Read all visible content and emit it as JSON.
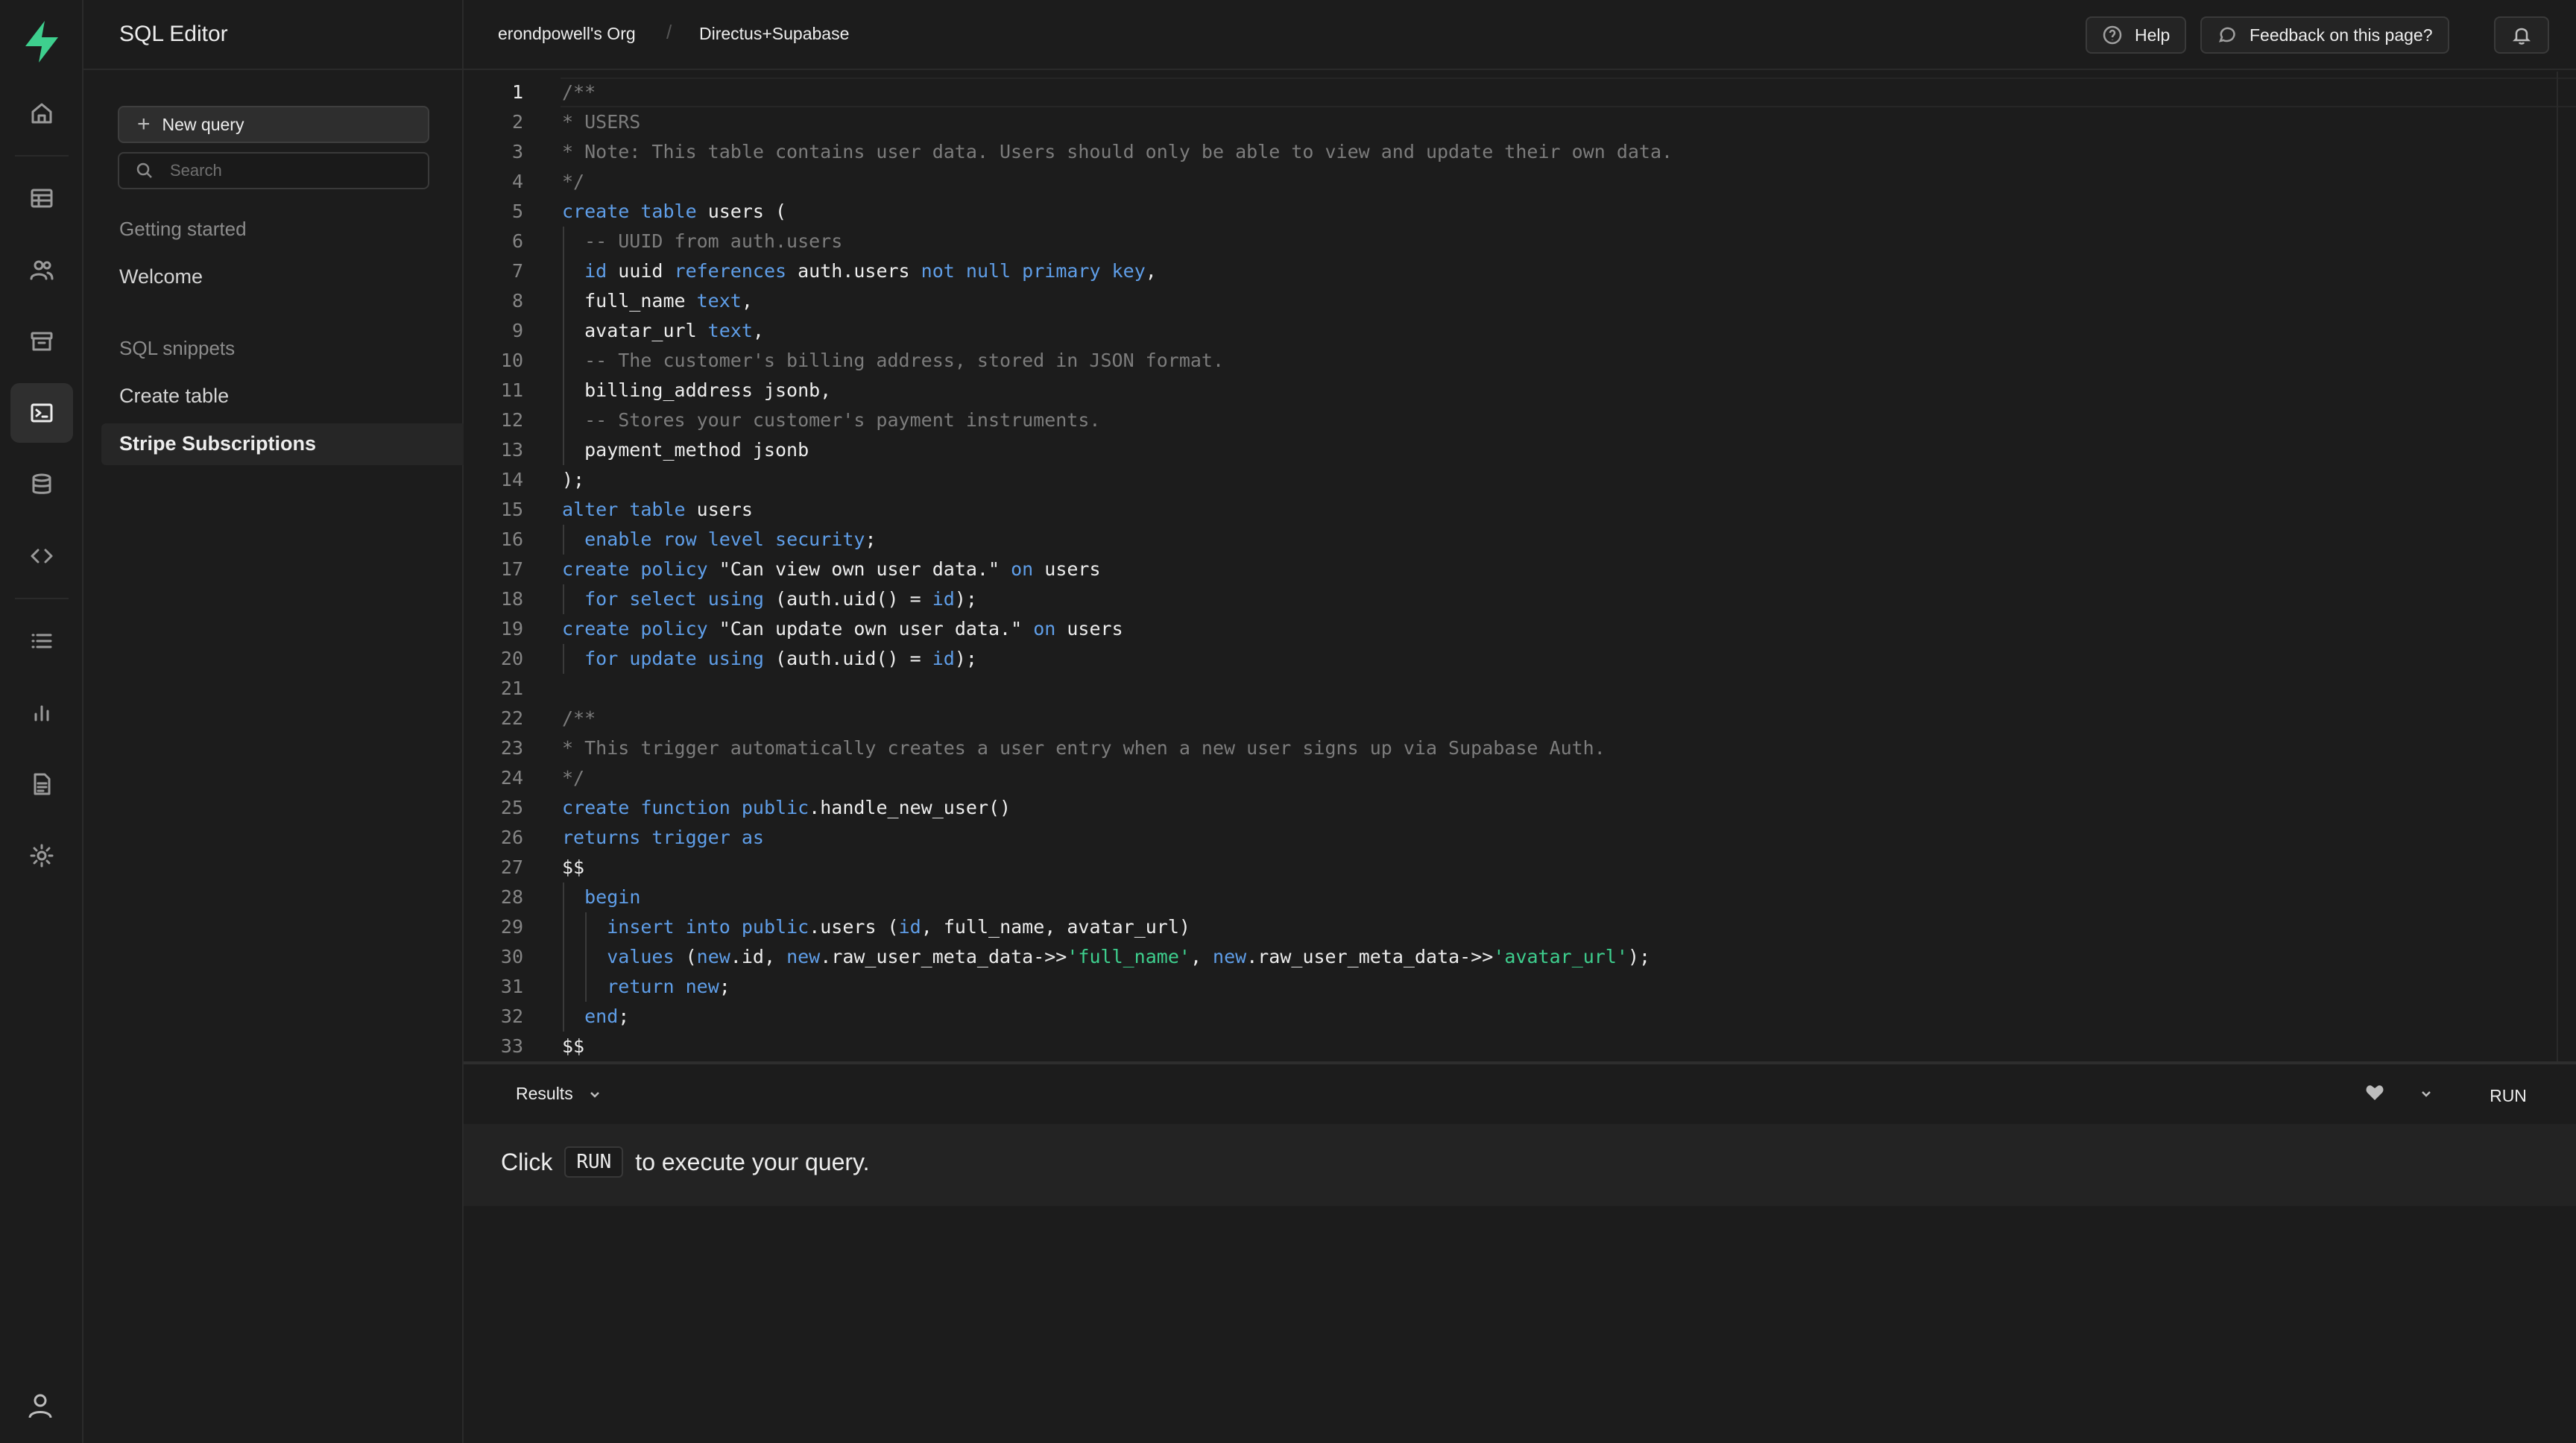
{
  "app": {
    "title": "SQL Editor"
  },
  "rail": {
    "icons": [
      "home-icon",
      "table-editor-icon",
      "users-icon",
      "storage-icon",
      "sql-editor-icon",
      "database-icon",
      "api-icon",
      "logs-icon",
      "reports-icon",
      "docs-icon",
      "settings-icon",
      "account-icon"
    ],
    "active": "sql-editor-icon",
    "brand_color": "#3ecf8e"
  },
  "sidebar": {
    "new_query_label": "New query",
    "search_placeholder": "Search",
    "section_getting_started": "Getting started",
    "item_welcome": "Welcome",
    "section_snippets": "SQL snippets",
    "item_create_table": "Create table",
    "item_active": "Stripe Subscriptions"
  },
  "topbar": {
    "org": "erondpowell's Org",
    "separator": "/",
    "project": "Directus+Supabase",
    "help_label": "Help",
    "feedback_label": "Feedback on this page?"
  },
  "editor": {
    "lines": [
      "/**",
      "* USERS",
      "* Note: This table contains user data. Users should only be able to view and update their own data.",
      "*/",
      "create table users (",
      "  -- UUID from auth.users",
      "  id uuid references auth.users not null primary key,",
      "  full_name text,",
      "  avatar_url text,",
      "  -- The customer's billing address, stored in JSON format.",
      "  billing_address jsonb,",
      "  -- Stores your customer's payment instruments.",
      "  payment_method jsonb",
      ");",
      "alter table users",
      "  enable row level security;",
      "create policy \"Can view own user data.\" on users",
      "  for select using (auth.uid() = id);",
      "create policy \"Can update own user data.\" on users",
      "  for update using (auth.uid() = id);",
      "",
      "/**",
      "* This trigger automatically creates a user entry when a new user signs up via Supabase Auth.",
      "*/",
      "create function public.handle_new_user()",
      "returns trigger as",
      "$$",
      "  begin",
      "    insert into public.users (id, full_name, avatar_url)",
      "    values (new.id, new.raw_user_meta_data->>'full_name', new.raw_user_meta_data->>'avatar_url');",
      "    return new;",
      "  end;",
      "$$"
    ],
    "colors": {
      "keyword": "#5f9ee8",
      "comment": "#7c7c7c",
      "string_literal": "#3ecf8e",
      "text": "#ededed"
    }
  },
  "results": {
    "tab_label": "Results",
    "run_label": "RUN",
    "message_prefix": "Click",
    "message_kbd": "RUN",
    "message_suffix": "to execute your query."
  }
}
